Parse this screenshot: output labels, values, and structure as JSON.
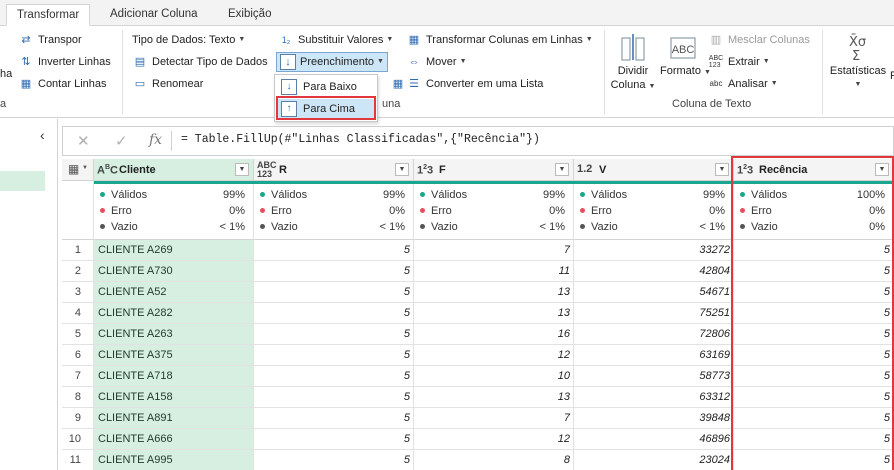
{
  "tabs": [
    "Transformar",
    "Adicionar Coluna",
    "Exibição"
  ],
  "ribbon": {
    "col1": [
      "Transpor",
      "Inverter Linhas",
      "Contar Linhas"
    ],
    "col1_left_fragments": [
      "ha",
      "a"
    ],
    "tipo_dados": "Tipo de Dados: Texto",
    "detectar": "Detectar Tipo de Dados",
    "renomear": "Renomear",
    "substituir": "Substituir Valores",
    "preenchimento": "Preenchimento",
    "transformar_colunas": "Transformar Colunas em Linhas",
    "mover": "Mover",
    "converter": "Converter em uma Lista",
    "group_label_fragment": "una",
    "dividir": [
      "Dividir",
      "Coluna"
    ],
    "formato": "Formato",
    "mesclar": "Mesclar Colunas",
    "extrair": "Extrair",
    "analisar": "Analisar",
    "group_coluna_texto": "Coluna de Texto",
    "estatisticas": "Estatísticas",
    "estatisticas_fragment": "F"
  },
  "dropdown": {
    "items": [
      "Para Baixo",
      "Para Cima"
    ]
  },
  "formula": {
    "text": "= Table.FillUp(#\"Linhas Classificadas\",{\"Recência\"})"
  },
  "columns": [
    {
      "type_top": "A",
      "type_sub": "B",
      "type_bot": "C",
      "name": "Cliente",
      "valid": "99%",
      "error": "0%",
      "empty": "< 1%"
    },
    {
      "type_top": "ABC",
      "type_bot": "123",
      "name": "R",
      "valid": "99%",
      "error": "0%",
      "empty": "< 1%"
    },
    {
      "type_top": "1",
      "type_sub": "2",
      "type_bot": "3",
      "name": "F",
      "valid": "99%",
      "error": "0%",
      "empty": "< 1%"
    },
    {
      "type_top": "1.2",
      "name": "V",
      "valid": "99%",
      "error": "0%",
      "empty": "< 1%"
    },
    {
      "type_top": "1",
      "type_sub": "2",
      "type_bot": "3",
      "name": "Recência",
      "valid": "100%",
      "error": "0%",
      "empty": "0%"
    }
  ],
  "quality_labels": [
    "Válidos",
    "Erro",
    "Vazio"
  ],
  "colors": {
    "valid": "#1aa58f",
    "error": "#e8505b",
    "empty": "#555555",
    "accent": "#e0383e",
    "selected": "#d6efe1"
  },
  "rows": [
    [
      "1",
      "CLIENTE A269",
      "5",
      "7",
      "33272",
      "5"
    ],
    [
      "2",
      "CLIENTE A730",
      "5",
      "11",
      "42804",
      "5"
    ],
    [
      "3",
      "CLIENTE A52",
      "5",
      "13",
      "54671",
      "5"
    ],
    [
      "4",
      "CLIENTE A282",
      "5",
      "13",
      "75251",
      "5"
    ],
    [
      "5",
      "CLIENTE A263",
      "5",
      "16",
      "72806",
      "5"
    ],
    [
      "6",
      "CLIENTE A375",
      "5",
      "12",
      "63169",
      "5"
    ],
    [
      "7",
      "CLIENTE A718",
      "5",
      "10",
      "58773",
      "5"
    ],
    [
      "8",
      "CLIENTE A158",
      "5",
      "13",
      "63312",
      "5"
    ],
    [
      "9",
      "CLIENTE A891",
      "5",
      "7",
      "39848",
      "5"
    ],
    [
      "10",
      "CLIENTE A666",
      "5",
      "12",
      "46896",
      "5"
    ],
    [
      "11",
      "CLIENTE A995",
      "5",
      "8",
      "23024",
      "5"
    ]
  ]
}
